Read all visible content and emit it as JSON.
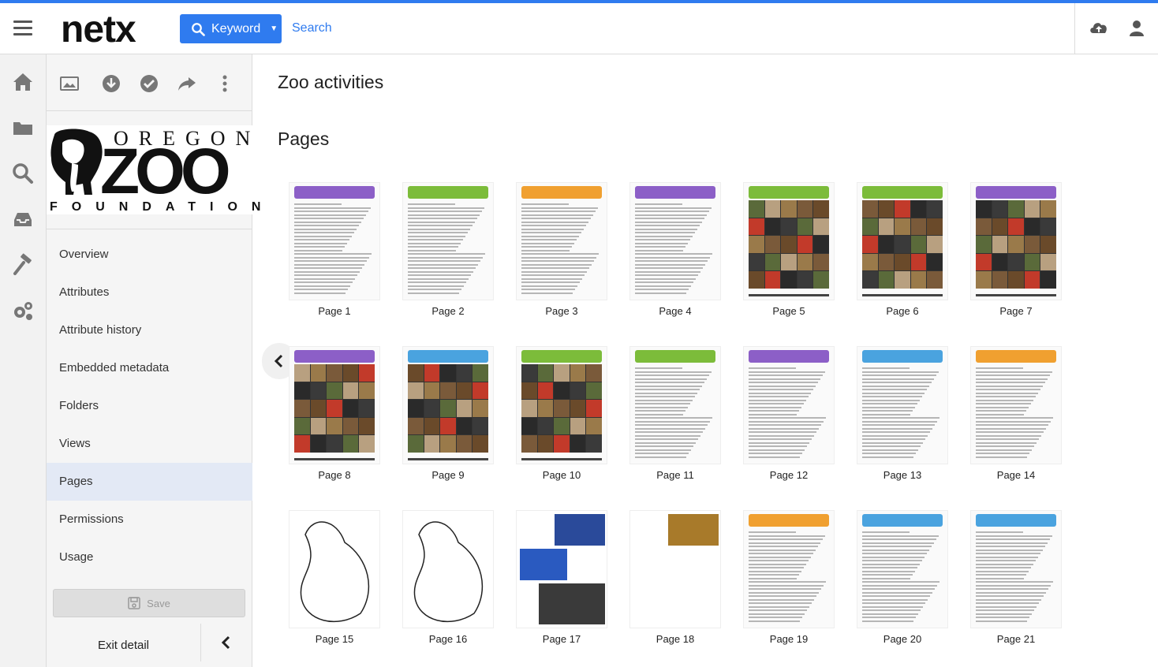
{
  "header": {
    "brand": "netx",
    "keyword_label": "Keyword",
    "search_label": "Search"
  },
  "panel": {
    "brand": {
      "top": "OREGON",
      "middle": "ZOO",
      "bottom": "FOUNDATION"
    },
    "nav": [
      {
        "label": "Overview",
        "active": false
      },
      {
        "label": "Attributes",
        "active": false
      },
      {
        "label": "Attribute history",
        "active": false
      },
      {
        "label": "Embedded metadata",
        "active": false
      },
      {
        "label": "Folders",
        "active": false
      },
      {
        "label": "Views",
        "active": false
      },
      {
        "label": "Pages",
        "active": true
      },
      {
        "label": "Permissions",
        "active": false
      },
      {
        "label": "Usage",
        "active": false
      }
    ],
    "save_label": "Save",
    "exit_label": "Exit detail"
  },
  "main": {
    "title": "Zoo activities",
    "section_title": "Pages",
    "pages": [
      {
        "label": "Page 1",
        "kind": "doc",
        "color": "#8c5fc7"
      },
      {
        "label": "Page 2",
        "kind": "doc",
        "color": "#7cbc3a"
      },
      {
        "label": "Page 3",
        "kind": "doc",
        "color": "#f0a030"
      },
      {
        "label": "Page 4",
        "kind": "doc",
        "color": "#8c5fc7"
      },
      {
        "label": "Page 5",
        "kind": "bingo",
        "color": "#7cbc3a"
      },
      {
        "label": "Page 6",
        "kind": "bingo",
        "color": "#7cbc3a"
      },
      {
        "label": "Page 7",
        "kind": "bingo",
        "color": "#8c5fc7"
      },
      {
        "label": "Page 8",
        "kind": "bingo",
        "color": "#8c5fc7"
      },
      {
        "label": "Page 9",
        "kind": "bingo",
        "color": "#4aa3df"
      },
      {
        "label": "Page 10",
        "kind": "bingo",
        "color": "#7cbc3a"
      },
      {
        "label": "Page 11",
        "kind": "doc",
        "color": "#7cbc3a"
      },
      {
        "label": "Page 12",
        "kind": "doc",
        "color": "#8c5fc7"
      },
      {
        "label": "Page 13",
        "kind": "doc",
        "color": "#4aa3df"
      },
      {
        "label": "Page 14",
        "kind": "doc",
        "color": "#f0a030"
      },
      {
        "label": "Page 15",
        "kind": "cutout",
        "color": "#333333"
      },
      {
        "label": "Page 16",
        "kind": "cutout",
        "color": "#333333"
      },
      {
        "label": "Page 17",
        "kind": "photo",
        "color": "#2a4a9a"
      },
      {
        "label": "Page 18",
        "kind": "photo",
        "color": "#a87a2a"
      },
      {
        "label": "Page 19",
        "kind": "doc",
        "color": "#f0a030"
      },
      {
        "label": "Page 20",
        "kind": "doc",
        "color": "#4aa3df"
      },
      {
        "label": "Page 21",
        "kind": "doc",
        "color": "#4aa3df"
      }
    ]
  },
  "colors": {
    "accent": "#2f7bef",
    "active_nav": "#e3e9f5"
  }
}
